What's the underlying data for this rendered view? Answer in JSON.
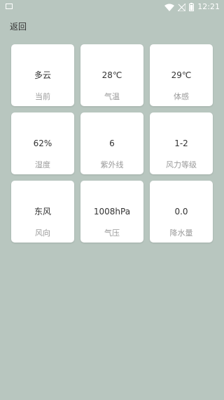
{
  "status_bar": {
    "time": "12:21",
    "icons": [
      "image-icon",
      "wifi-icon",
      "signal-icon",
      "battery-icon"
    ]
  },
  "header": {
    "back_label": "返回"
  },
  "cards": [
    {
      "value": "多云",
      "label": "当前"
    },
    {
      "value": "28℃",
      "label": "气温"
    },
    {
      "value": "29℃",
      "label": "体感"
    },
    {
      "value": "62%",
      "label": "湿度"
    },
    {
      "value": "6",
      "label": "紫外线"
    },
    {
      "value": "1-2",
      "label": "风力等级"
    },
    {
      "value": "东风",
      "label": "风向"
    },
    {
      "value": "1008hPa",
      "label": "气压"
    },
    {
      "value": "0.0",
      "label": "降水量"
    }
  ],
  "colors": {
    "background": "#b8c6bf",
    "card": "#ffffff",
    "value_text": "#333333",
    "label_text": "#9a9a9a"
  }
}
